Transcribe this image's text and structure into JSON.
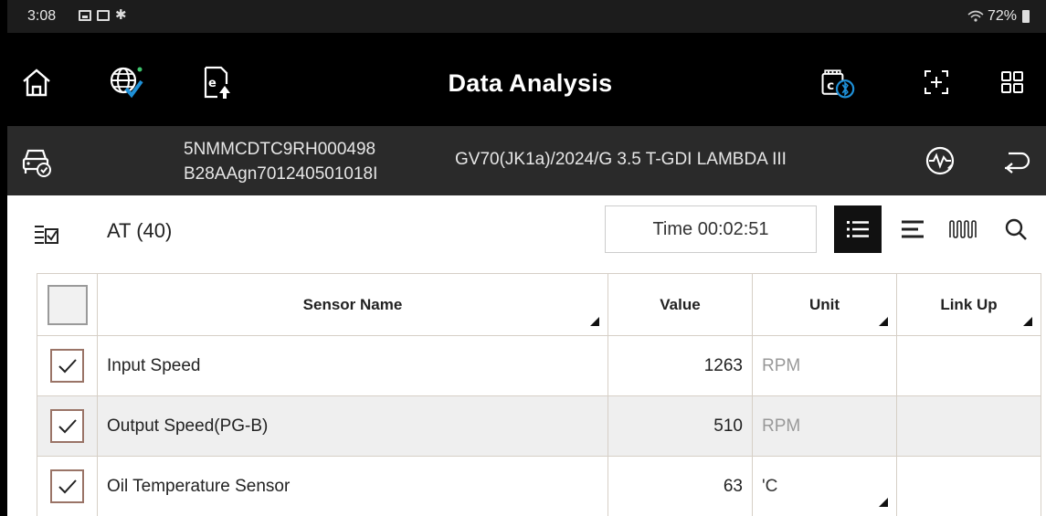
{
  "status_bar": {
    "time": "3:08",
    "battery": "72%"
  },
  "header": {
    "title": "Data Analysis"
  },
  "vehicle": {
    "vin": "5NMMCDTC9RH000498",
    "calibration_id": "B28AAgn701240501018I",
    "model": "GV70(JK1a)/2024/G 3.5 T-GDI LAMBDA III"
  },
  "toolbar": {
    "group_label": "AT (40)",
    "time_label": "Time 00:02:51"
  },
  "table": {
    "headers": {
      "sensor_name": "Sensor Name",
      "value": "Value",
      "unit": "Unit",
      "link_up": "Link Up"
    },
    "rows": [
      {
        "name": "Input Speed",
        "value": "1263",
        "unit": "RPM",
        "link_up": ""
      },
      {
        "name": "Output Speed(PG-B)",
        "value": "510",
        "unit": "RPM",
        "link_up": ""
      },
      {
        "name": "Oil Temperature Sensor",
        "value": "63",
        "unit": "'C",
        "link_up": ""
      }
    ]
  },
  "colors": {
    "header_bg": "#000000",
    "vehicle_bar_bg": "#2a2a2a",
    "checkbox_border": "#9a7467",
    "alt_row_bg": "#efefef",
    "accent_blue": "#1e90d8"
  }
}
